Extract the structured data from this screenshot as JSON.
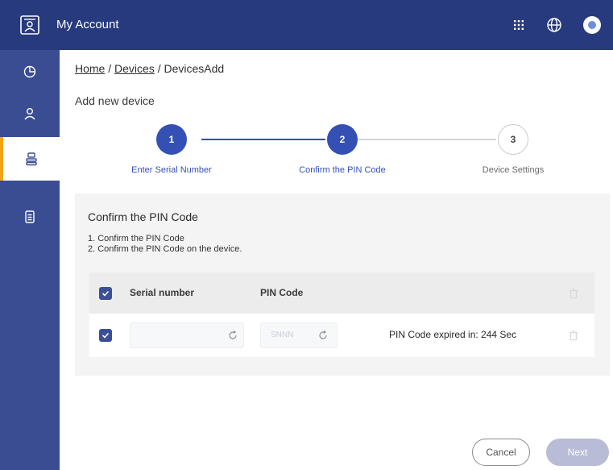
{
  "header": {
    "title": "My Account",
    "icons": [
      "account-logo-icon",
      "apps-grid-icon",
      "globe-icon",
      "avatar"
    ]
  },
  "sidebar": {
    "items": [
      {
        "icon": "dashboard-icon",
        "active": false
      },
      {
        "icon": "user-icon",
        "active": false
      },
      {
        "icon": "device-icon",
        "active": true
      },
      {
        "icon": "document-icon",
        "active": false
      }
    ]
  },
  "breadcrumb": {
    "home": "Home",
    "sep1": " / ",
    "devices": "Devices",
    "sep2": " / ",
    "current": "DevicesAdd"
  },
  "page": {
    "title": "Add new device"
  },
  "stepper": {
    "steps": [
      {
        "number": "1",
        "label": "Enter Serial Number",
        "state": "done"
      },
      {
        "number": "2",
        "label": "Confirm the PIN Code",
        "state": "done"
      },
      {
        "number": "3",
        "label": "Device Settings",
        "state": "todo"
      }
    ]
  },
  "panel": {
    "title": "Confirm the PIN Code",
    "instructions": [
      "1. Confirm the PIN Code",
      "2. Confirm the PIN Code on the device."
    ]
  },
  "table": {
    "headers": {
      "serial": "Serial number",
      "pin": "PIN Code"
    },
    "rows": [
      {
        "checked": true,
        "serial": "",
        "pin_placeholder": "SNNN",
        "expiry": "PIN Code expired in: 244 Sec"
      }
    ]
  },
  "footer": {
    "cancel": "Cancel",
    "next": "Next"
  },
  "colors": {
    "topbar": "#283a7e",
    "sidebar": "#3a4d92",
    "primary": "#3550b5",
    "active_indicator": "#f1a51b",
    "next_disabled": "#b8bcd6"
  }
}
